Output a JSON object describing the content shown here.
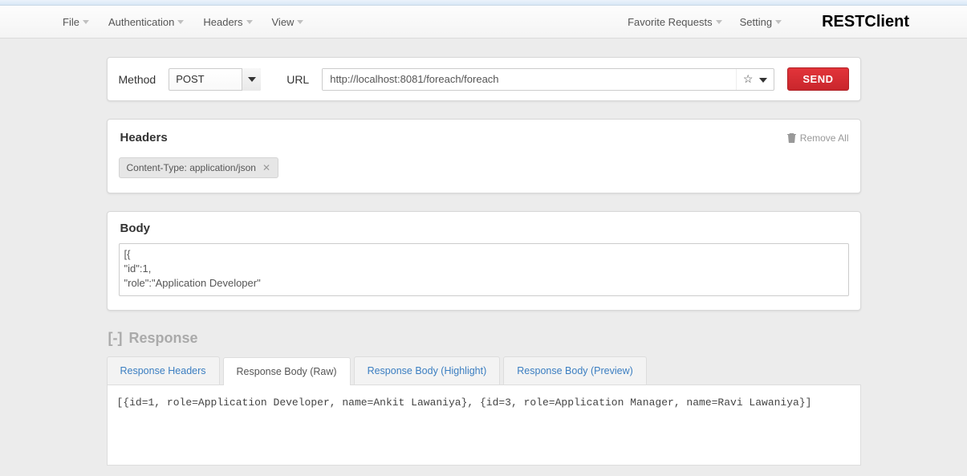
{
  "menu": {
    "left": [
      "File",
      "Authentication",
      "Headers",
      "View"
    ],
    "right": [
      "Favorite Requests",
      "Setting"
    ],
    "brand": "RESTClient"
  },
  "request": {
    "method_label": "Method",
    "method_value": "POST",
    "url_label": "URL",
    "url_value": "http://localhost:8081/foreach/foreach",
    "send_label": "SEND"
  },
  "headers": {
    "title": "Headers",
    "remove_all_label": "Remove All",
    "chips": [
      {
        "text": "Content-Type: application/json"
      }
    ]
  },
  "body": {
    "title": "Body",
    "content": "[{\n\"id\":1,\n\"role\":\"Application Developer\""
  },
  "response": {
    "toggle": "[-]",
    "title": "Response",
    "tabs": [
      {
        "label": "Response Headers",
        "active": false
      },
      {
        "label": "Response Body (Raw)",
        "active": true
      },
      {
        "label": "Response Body (Highlight)",
        "active": false
      },
      {
        "label": "Response Body (Preview)",
        "active": false
      }
    ],
    "raw": "[{id=1, role=Application Developer, name=Ankit Lawaniya}, {id=3, role=Application Manager, name=Ravi Lawaniya}]"
  }
}
